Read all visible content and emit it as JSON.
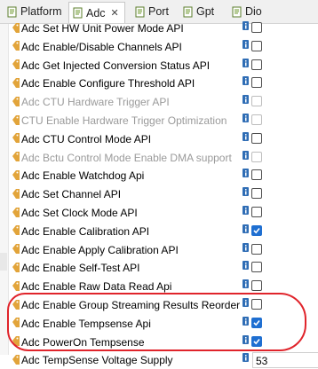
{
  "tabs": [
    {
      "label": "Platform",
      "active": false,
      "closable": false
    },
    {
      "label": "Adc",
      "active": true,
      "closable": true,
      "close_glyph": "✕"
    },
    {
      "label": "Port",
      "active": false,
      "closable": false
    },
    {
      "label": "Gpt",
      "active": false,
      "closable": false
    },
    {
      "label": "Dio",
      "active": false,
      "closable": false
    }
  ],
  "rows": [
    {
      "label": "Adc Set HW Unit Power Mode API",
      "enabled": true,
      "type": "checkbox",
      "checked": false
    },
    {
      "label": "Adc Enable/Disable Channels API",
      "enabled": true,
      "type": "checkbox",
      "checked": false
    },
    {
      "label": "Adc Get Injected Conversion Status API",
      "enabled": true,
      "type": "checkbox",
      "checked": false
    },
    {
      "label": "Adc Enable Configure Threshold API",
      "enabled": true,
      "type": "checkbox",
      "checked": false
    },
    {
      "label": "Adc CTU Hardware Trigger API",
      "enabled": false,
      "type": "checkbox",
      "checked": false
    },
    {
      "label": "CTU Enable Hardware Trigger Optimization",
      "enabled": false,
      "type": "checkbox",
      "checked": false
    },
    {
      "label": "Adc CTU Control Mode API",
      "enabled": true,
      "type": "checkbox",
      "checked": false
    },
    {
      "label": "Adc Bctu Control Mode Enable DMA support",
      "enabled": false,
      "type": "checkbox",
      "checked": false
    },
    {
      "label": "Adc Enable Watchdog Api",
      "enabled": true,
      "type": "checkbox",
      "checked": false
    },
    {
      "label": "Adc Set Channel API",
      "enabled": true,
      "type": "checkbox",
      "checked": false
    },
    {
      "label": "Adc Set Clock Mode API",
      "enabled": true,
      "type": "checkbox",
      "checked": false
    },
    {
      "label": "Adc Enable Calibration API",
      "enabled": true,
      "type": "checkbox",
      "checked": true
    },
    {
      "label": "Adc Enable Apply Calibration API",
      "enabled": true,
      "type": "checkbox",
      "checked": false
    },
    {
      "label": "Adc Enable Self-Test API",
      "enabled": true,
      "type": "checkbox",
      "checked": false
    },
    {
      "label": "Adc Enable Raw Data Read Api",
      "enabled": true,
      "type": "checkbox",
      "checked": false
    },
    {
      "label": "Adc Enable Group Streaming Results Reorder",
      "enabled": true,
      "type": "checkbox",
      "checked": false
    },
    {
      "label": "Adc Enable Tempsense Api",
      "enabled": true,
      "type": "checkbox",
      "checked": true
    },
    {
      "label": "Adc PowerOn Tempsense",
      "enabled": true,
      "type": "checkbox",
      "checked": true
    },
    {
      "label": "Adc TempSense Voltage Supply",
      "enabled": true,
      "type": "number",
      "value": "53"
    }
  ],
  "colors": {
    "accent": "#1f6fd1",
    "highlight_circle": "#e0242b",
    "disabled_text": "#9a9a9a"
  }
}
